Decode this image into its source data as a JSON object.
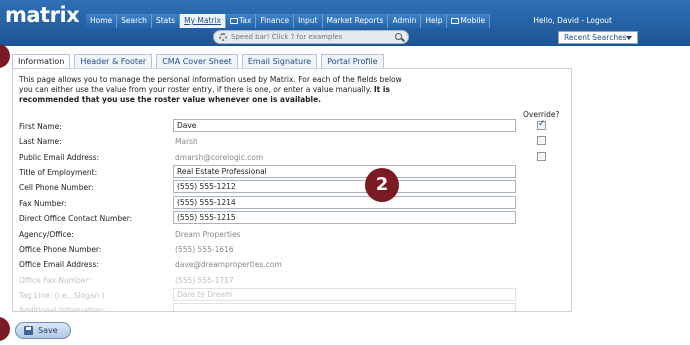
{
  "app": {
    "logo_text": "matrix"
  },
  "nav": {
    "items": [
      {
        "label": "Home",
        "active": false,
        "icon": false
      },
      {
        "label": "Search",
        "active": false,
        "icon": false
      },
      {
        "label": "Stats",
        "active": false,
        "icon": false
      },
      {
        "label": "My Matrix",
        "active": true,
        "icon": false
      },
      {
        "label": "Tax",
        "active": false,
        "icon": true
      },
      {
        "label": "Finance",
        "active": false,
        "icon": false
      },
      {
        "label": "Input",
        "active": false,
        "icon": false
      },
      {
        "label": "Market Reports",
        "active": false,
        "icon": false
      },
      {
        "label": "Admin",
        "active": false,
        "icon": false
      },
      {
        "label": "Help",
        "active": false,
        "icon": false
      },
      {
        "label": "Mobile",
        "active": false,
        "icon": true
      }
    ],
    "greeting": "Hello, David - Logout"
  },
  "speedbar": {
    "placeholder": "Speed bar! Click ? for examples"
  },
  "recent_searches": {
    "label": "Recent Searches"
  },
  "tabs": [
    {
      "label": "Information",
      "active": true
    },
    {
      "label": "Header & Footer",
      "active": false
    },
    {
      "label": "CMA Cover Sheet",
      "active": false
    },
    {
      "label": "Email Signature",
      "active": false
    },
    {
      "label": "Portal Profile",
      "active": false
    }
  ],
  "intro": {
    "text_plain": "This page allows you to manage the personal information used by Matrix. For each of the fields below you can either use the value from your roster entry, if there is one, or enter a value manually.",
    "text_bold": "It is recommended that you use the roster value whenever one is available."
  },
  "override_header": "Override?",
  "fields": [
    {
      "label": "First Name:",
      "value": "Dave",
      "kind": "input",
      "override": true,
      "style": "normal"
    },
    {
      "label": "Last Name:",
      "value": "Marsh",
      "kind": "text",
      "override": false,
      "style": "normal"
    },
    {
      "label": "Public Email Address:",
      "value": "dmarsh@corelogic.com",
      "kind": "text",
      "override": false,
      "style": "normal"
    },
    {
      "label": "Title of Employment:",
      "value": "Real Estate Professional",
      "kind": "input",
      "override": null,
      "style": "normal"
    },
    {
      "label": "Cell Phone Number:",
      "value": "(555) 555-1212",
      "kind": "input",
      "override": null,
      "style": "normal"
    },
    {
      "label": "Fax Number:",
      "value": "(555) 555-1214",
      "kind": "input",
      "override": null,
      "style": "normal"
    },
    {
      "label": "Direct Office Contact Number:",
      "value": "(555) 555-1215",
      "kind": "input",
      "override": null,
      "style": "normal"
    },
    {
      "label": "Agency/Office:",
      "value": "Dream Properties",
      "kind": "text",
      "override": null,
      "style": "dim"
    },
    {
      "label": "Office Phone Number:",
      "value": "(555) 555-1616",
      "kind": "text",
      "override": null,
      "style": "dim"
    },
    {
      "label": "Office Email Address:",
      "value": "dave@dreamproperties.com",
      "kind": "text",
      "override": null,
      "style": "dim"
    },
    {
      "label": "Office Fax Number:",
      "value": "(555) 555-1717",
      "kind": "text",
      "override": null,
      "style": "faint"
    },
    {
      "label": "Tag Line: (i.e., Slogan )",
      "value": "Dare to Dream",
      "kind": "input",
      "override": null,
      "style": "faint"
    },
    {
      "label": "Additional Information:",
      "value": "",
      "kind": "input",
      "override": null,
      "style": "faint"
    }
  ],
  "callout": {
    "number": "2"
  },
  "save": {
    "label": "Save"
  },
  "colors": {
    "header_blue": "#1d5597",
    "badge": "#7a1a22",
    "link": "#1d4f8d"
  }
}
